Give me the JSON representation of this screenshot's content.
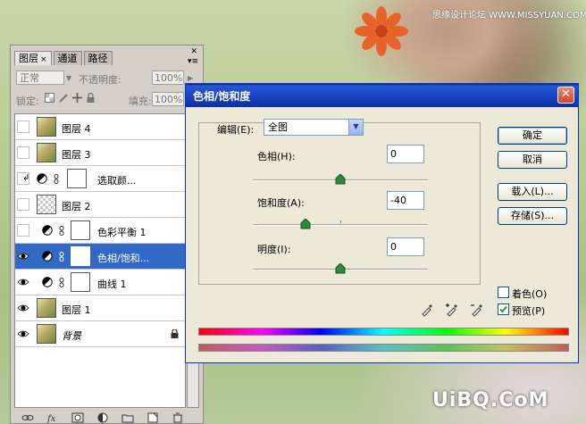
{
  "watermark": {
    "top": "思缘设计论坛 WWW.MISSYUAN.COM",
    "bottom": "UiBQ.CoM"
  },
  "layers_panel": {
    "tabs": [
      {
        "label": "图层",
        "close": "×",
        "active": true
      },
      {
        "label": "通道",
        "active": false
      },
      {
        "label": "路径",
        "active": false
      }
    ],
    "blend_mode": "正常",
    "opacity_label": "不透明度:",
    "opacity_value": "100%",
    "lock_label": "锁定:",
    "fill_label": "填充:",
    "fill_value": "100%",
    "layers": [
      {
        "name": "图层 4",
        "visible": false,
        "kind": "photo"
      },
      {
        "name": "图层 3",
        "visible": false,
        "kind": "photo"
      },
      {
        "name": "选取颜...",
        "visible": false,
        "kind": "adjustment",
        "clipped": true
      },
      {
        "name": "图层 2",
        "visible": false,
        "kind": "empty"
      },
      {
        "name": "色彩平衡 1",
        "visible": false,
        "kind": "adjustment"
      },
      {
        "name": "色相/饱和...",
        "visible": true,
        "kind": "adjustment",
        "selected": true
      },
      {
        "name": "曲线 1",
        "visible": true,
        "kind": "adjustment"
      },
      {
        "name": "图层 1",
        "visible": true,
        "kind": "photo"
      },
      {
        "name": "背景",
        "visible": true,
        "kind": "photo",
        "locked": true,
        "italic": true
      }
    ],
    "bottom_icons": [
      "link-icon",
      "fx-icon",
      "mask-icon",
      "adjustment-icon",
      "group-icon",
      "new-layer-icon",
      "trash-icon"
    ]
  },
  "dialog": {
    "title": "色相/饱和度",
    "edit_label": "编辑(E):",
    "edit_value": "全图",
    "hue_label": "色相(H):",
    "hue_value": "0",
    "hue_level": 0.5,
    "saturation_label": "饱和度(A):",
    "saturation_value": "-40",
    "saturation_level": 0.3,
    "lightness_label": "明度(I):",
    "lightness_value": "0",
    "lightness_level": 0.5,
    "buttons": {
      "ok": "确定",
      "cancel": "取消",
      "load": "载入(L)...",
      "save": "存储(S)..."
    },
    "colorize_label": "着色(O)",
    "colorize_checked": false,
    "preview_label": "预览(P)",
    "preview_checked": true
  }
}
